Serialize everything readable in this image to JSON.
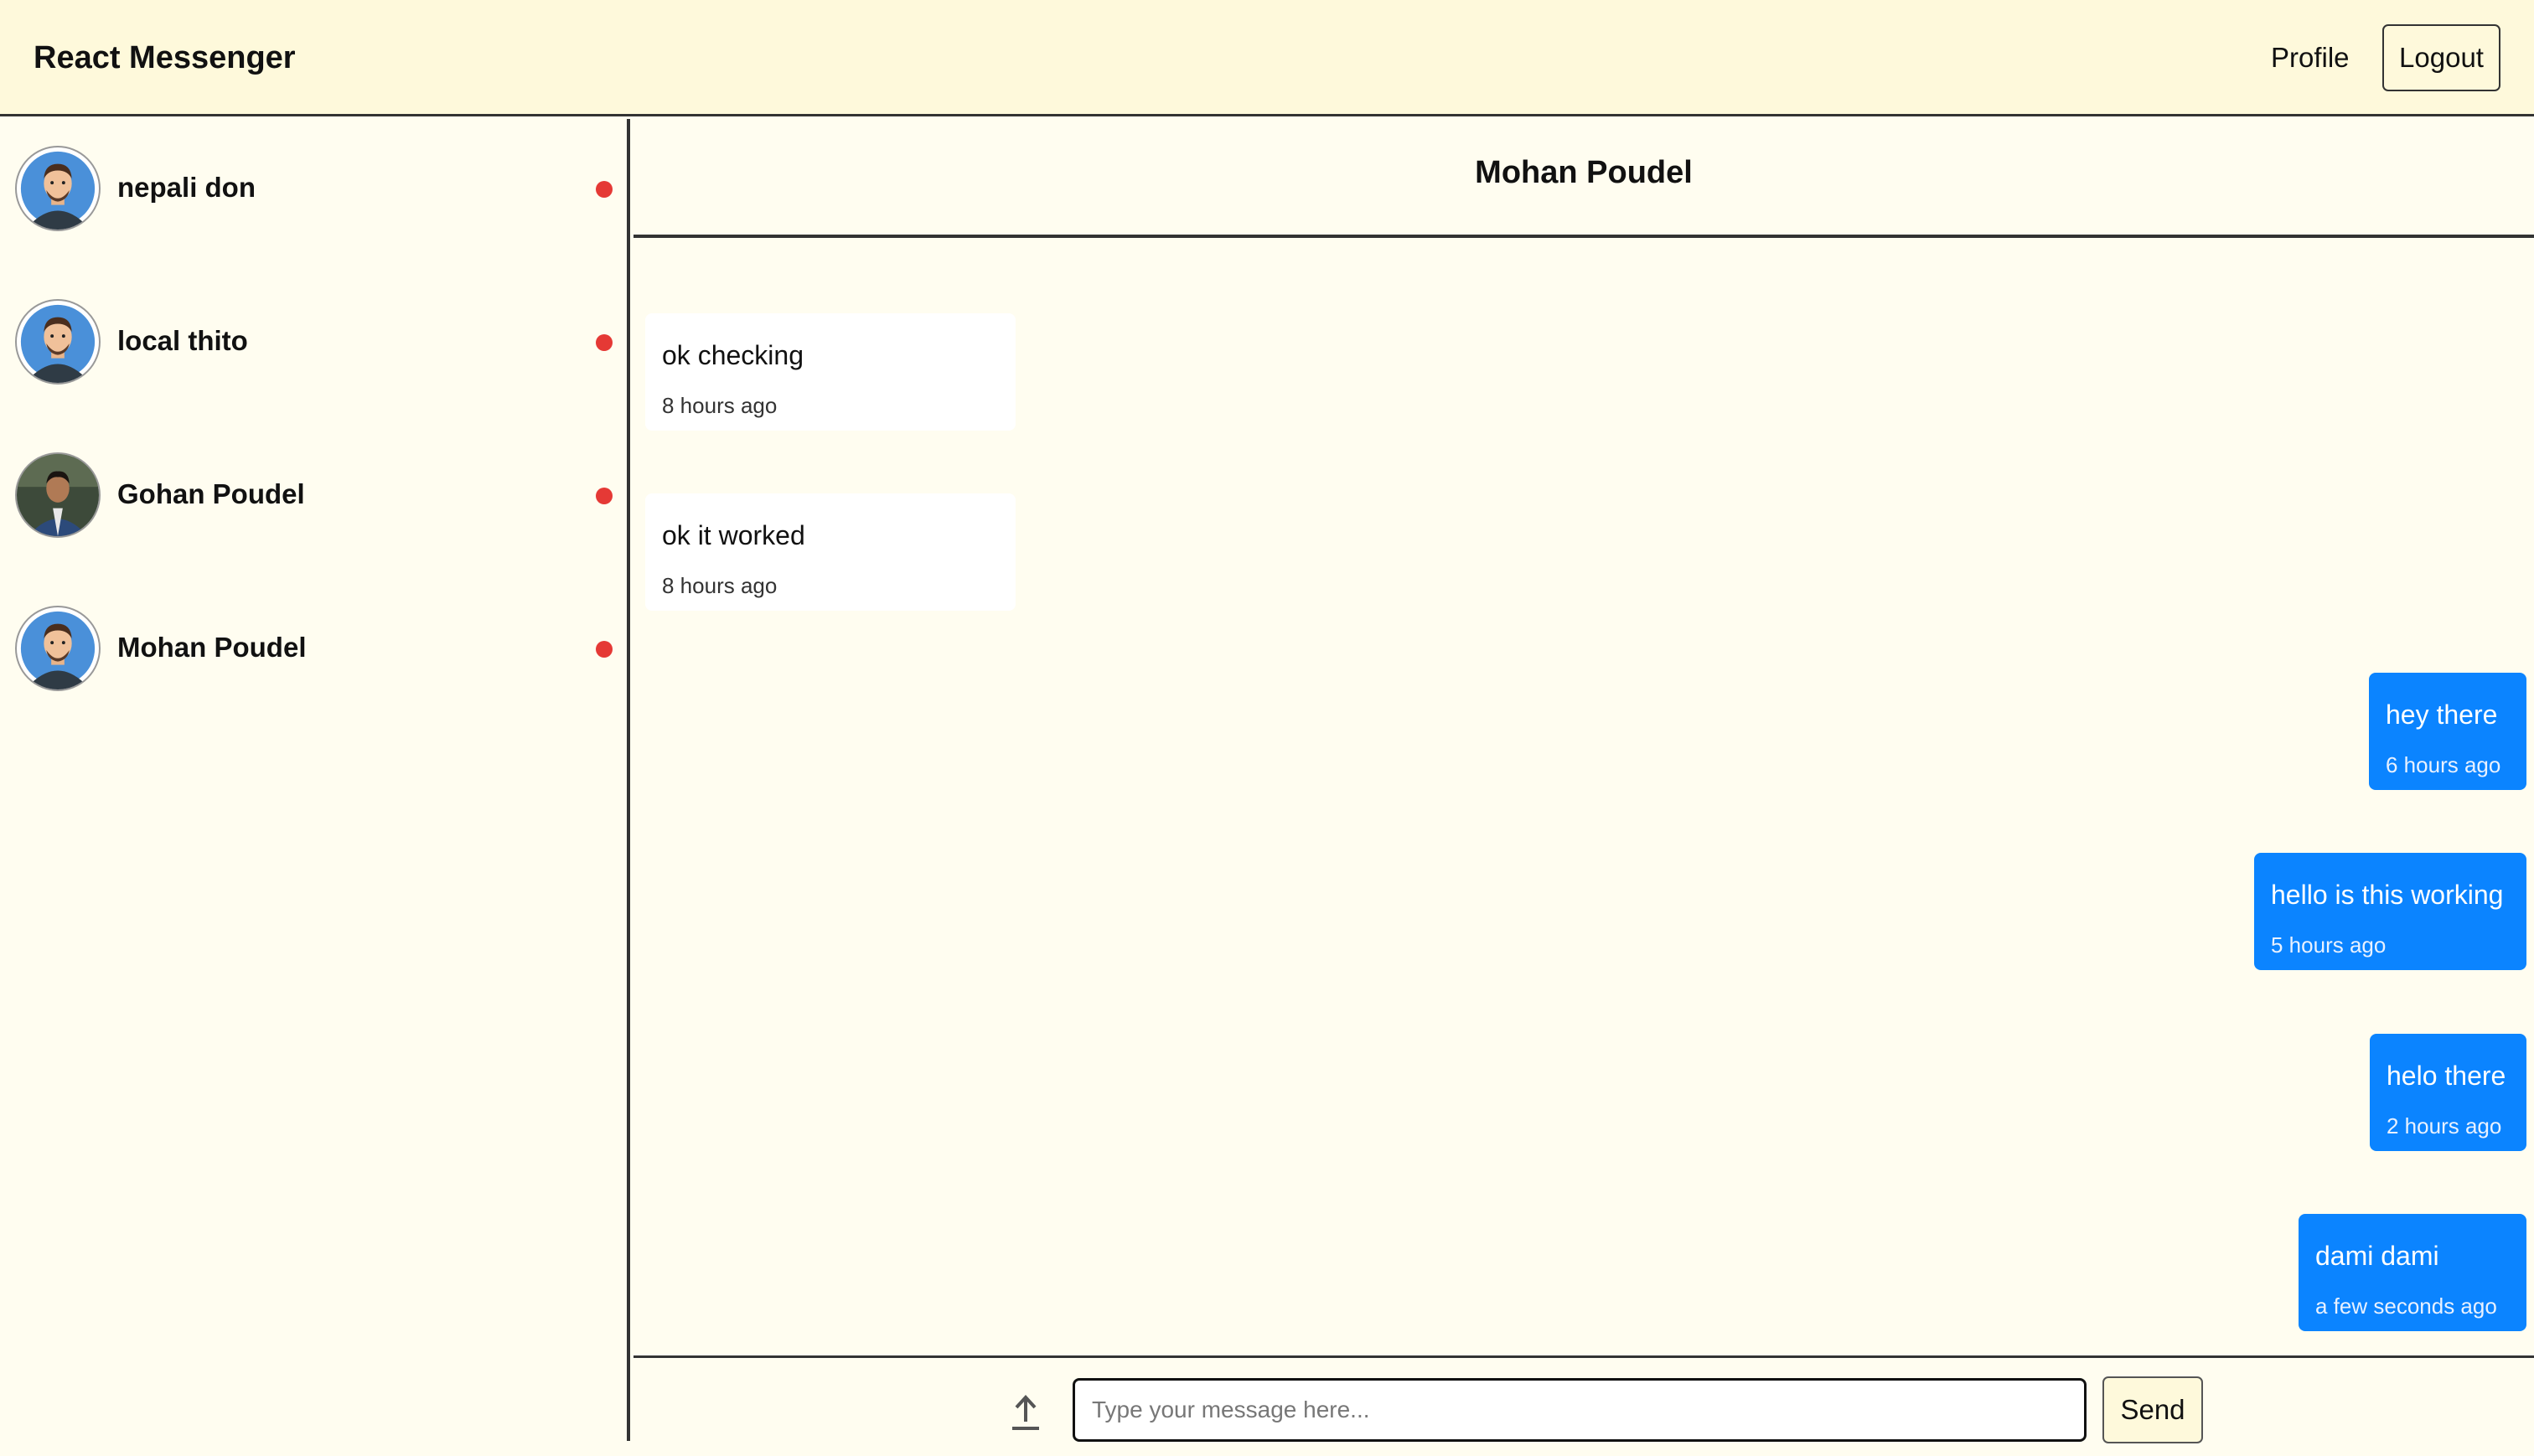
{
  "navbar": {
    "brand": "React Messenger",
    "profile_label": "Profile",
    "logout_label": "Logout"
  },
  "sidebar": {
    "contacts": [
      {
        "name": "nepali don",
        "avatar": "cartoon-avatar-icon",
        "status_color": "#e53935"
      },
      {
        "name": "local thito",
        "avatar": "cartoon-avatar-icon",
        "status_color": "#e53935"
      },
      {
        "name": "Gohan Poudel",
        "avatar": "photo-avatar",
        "status_color": "#e53935"
      },
      {
        "name": "Mohan Poudel",
        "avatar": "cartoon-avatar-icon",
        "status_color": "#e53935"
      }
    ]
  },
  "chat": {
    "title": "Mohan Poudel",
    "messages": [
      {
        "direction": "in",
        "text": "ok checking",
        "time": "8 hours ago"
      },
      {
        "direction": "in",
        "text": "ok it worked",
        "time": "8 hours ago"
      },
      {
        "direction": "out",
        "text": "hey there",
        "time": "6 hours ago"
      },
      {
        "direction": "out",
        "text": "hello is this working",
        "time": "5 hours ago"
      },
      {
        "direction": "out",
        "text": "helo there",
        "time": "2 hours ago"
      },
      {
        "direction": "out",
        "text": "dami dami",
        "time": "a few seconds ago"
      }
    ]
  },
  "composer": {
    "upload_icon": "upload-arrow-icon",
    "input_value": "",
    "input_placeholder": "Type your message here...",
    "send_label": "Send"
  },
  "colors": {
    "page_background": "#fffdf0",
    "navbar_background": "#fef9db",
    "outgoing_bubble": "#0b84ff",
    "incoming_bubble": "#ffffff",
    "status_dot": "#e53935"
  }
}
